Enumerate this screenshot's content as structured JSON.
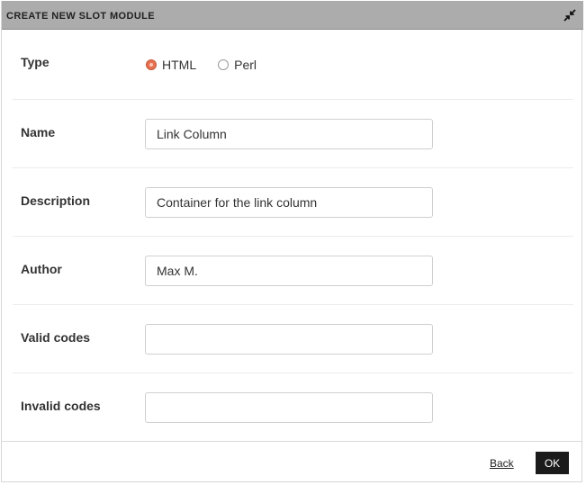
{
  "dialog": {
    "title": "CREATE NEW SLOT MODULE",
    "collapse_icon": "collapse-arrows-icon"
  },
  "form": {
    "type": {
      "label": "Type",
      "options": [
        {
          "label": "HTML",
          "selected": true
        },
        {
          "label": "Perl",
          "selected": false
        }
      ]
    },
    "name": {
      "label": "Name",
      "value": "Link Column",
      "placeholder": ""
    },
    "description": {
      "label": "Description",
      "value": "Container for the link column",
      "placeholder": ""
    },
    "author": {
      "label": "Author",
      "value": "Max M.",
      "placeholder": ""
    },
    "valid_codes": {
      "label": "Valid codes",
      "value": "",
      "placeholder": ""
    },
    "invalid_codes": {
      "label": "Invalid codes",
      "value": "",
      "placeholder": ""
    }
  },
  "footer": {
    "back_label": "Back",
    "ok_label": "OK"
  },
  "colors": {
    "titlebar": "#acacac",
    "radio_accent": "#e8704e",
    "ok_button": "#1b1b1b"
  }
}
